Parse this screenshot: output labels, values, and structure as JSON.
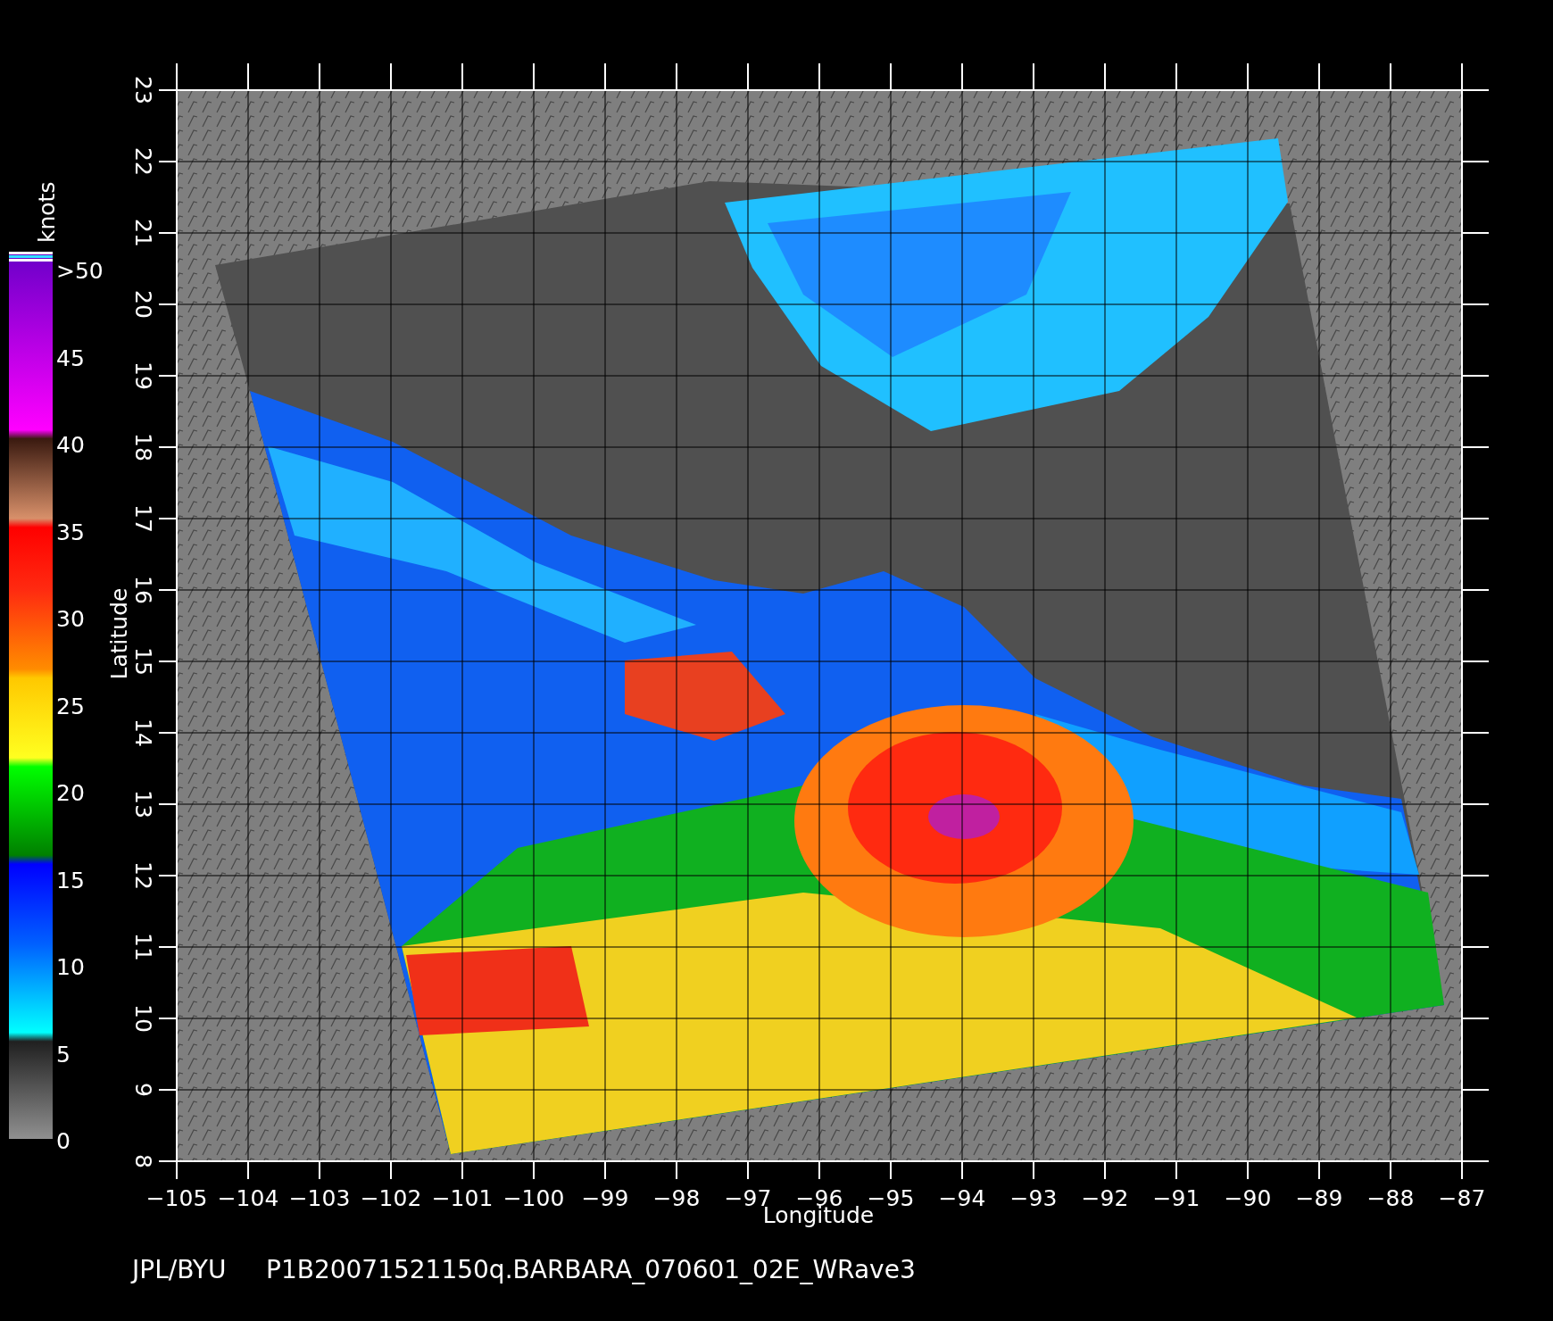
{
  "figure": {
    "colorbar": {
      "unit": "knots",
      "labels": [
        ">50",
        "45",
        "40",
        "35",
        "30",
        "25",
        "20",
        "15",
        "10",
        "5",
        "0"
      ]
    },
    "y_axis": {
      "label": "Latitude",
      "ticks": [
        "8",
        "9",
        "10",
        "11",
        "12",
        "13",
        "14",
        "15",
        "16",
        "17",
        "18",
        "19",
        "20",
        "21",
        "22",
        "23"
      ]
    },
    "x_axis": {
      "label": "Longitude",
      "ticks": [
        "−105",
        "−104",
        "−103",
        "−102",
        "−101",
        "−100",
        "−99",
        "−98",
        "−97",
        "−96",
        "−95",
        "−94",
        "−93",
        "−92",
        "−91",
        "−90",
        "−89",
        "−88",
        "−87"
      ]
    },
    "caption": {
      "source": "JPL/BYU",
      "file": "P1B20071521150q.BARBARA_070601_02E_WRave3"
    }
  }
}
